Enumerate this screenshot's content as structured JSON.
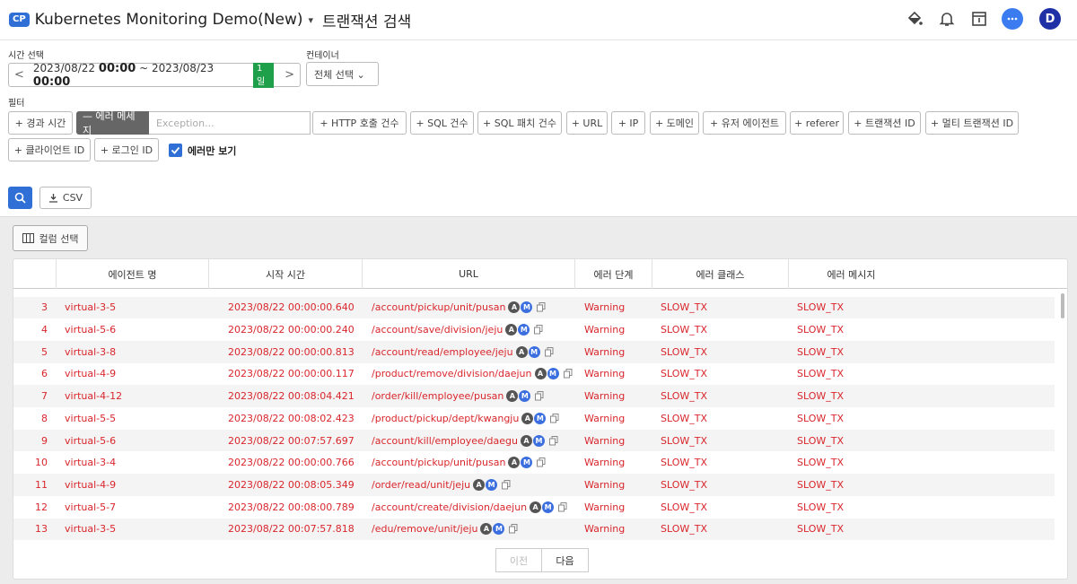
{
  "header": {
    "badge": "CP",
    "project": "Kubernetes Monitoring Demo(New)",
    "caret": "▾",
    "title": "트랜잭션 검색",
    "avatar": "D"
  },
  "filters": {
    "time_label": "시간 선택",
    "time_prev": "<",
    "time_next": ">",
    "time_from_date": "2023/08/22",
    "time_from_hm": "00:00",
    "time_sep": "~",
    "time_to_date": "2023/08/23",
    "time_to_hm": "00:00",
    "time_range": "1일",
    "container_label": "컨테이너",
    "container_value": "전체 선택 ⌄",
    "filter_label": "필터",
    "chips": [
      "+ 경과 시간",
      "+ HTTP 호출 건수",
      "+ SQL 건수",
      "+ SQL 패치 건수",
      "+ URL",
      "+ IP",
      "+ 도메인",
      "+ 유저 에이전트",
      "+ referer",
      "+ 트랜잭션 ID",
      "+ 멀티 트랜잭션 ID",
      "+ 클라이언트 ID",
      "+ 로그인 ID"
    ],
    "active_chip": "— 에러 메세지",
    "exception_placeholder": "Exception...",
    "errors_only_label": "에러만 보기",
    "csv_label": "CSV"
  },
  "table": {
    "column_select_label": "컬럼 선택",
    "columns": [
      "에이전트 명",
      "시작 시간",
      "URL",
      "에러 단계",
      "에러 클래스",
      "에러 메시지"
    ],
    "rows": [
      {
        "no": "3",
        "agent": "virtual-3-5",
        "time": "2023/08/22 00:00:00.640",
        "url": "/account/pickup/unit/pusan",
        "stage": "Warning",
        "cls": "SLOW_TX",
        "msg": "SLOW_TX"
      },
      {
        "no": "4",
        "agent": "virtual-5-6",
        "time": "2023/08/22 00:00:00.240",
        "url": "/account/save/division/jeju",
        "stage": "Warning",
        "cls": "SLOW_TX",
        "msg": "SLOW_TX"
      },
      {
        "no": "5",
        "agent": "virtual-3-8",
        "time": "2023/08/22 00:00:00.813",
        "url": "/account/read/employee/jeju",
        "stage": "Warning",
        "cls": "SLOW_TX",
        "msg": "SLOW_TX"
      },
      {
        "no": "6",
        "agent": "virtual-4-9",
        "time": "2023/08/22 00:00:00.117",
        "url": "/product/remove/division/daejun",
        "stage": "Warning",
        "cls": "SLOW_TX",
        "msg": "SLOW_TX"
      },
      {
        "no": "7",
        "agent": "virtual-4-12",
        "time": "2023/08/22 00:08:04.421",
        "url": "/order/kill/employee/pusan",
        "stage": "Warning",
        "cls": "SLOW_TX",
        "msg": "SLOW_TX"
      },
      {
        "no": "8",
        "agent": "virtual-5-5",
        "time": "2023/08/22 00:08:02.423",
        "url": "/product/pickup/dept/kwangju",
        "stage": "Warning",
        "cls": "SLOW_TX",
        "msg": "SLOW_TX"
      },
      {
        "no": "9",
        "agent": "virtual-5-6",
        "time": "2023/08/22 00:07:57.697",
        "url": "/account/kill/employee/daegu",
        "stage": "Warning",
        "cls": "SLOW_TX",
        "msg": "SLOW_TX"
      },
      {
        "no": "10",
        "agent": "virtual-3-4",
        "time": "2023/08/22 00:00:00.766",
        "url": "/account/pickup/unit/pusan",
        "stage": "Warning",
        "cls": "SLOW_TX",
        "msg": "SLOW_TX"
      },
      {
        "no": "11",
        "agent": "virtual-4-9",
        "time": "2023/08/22 00:08:05.349",
        "url": "/order/read/unit/jeju",
        "stage": "Warning",
        "cls": "SLOW_TX",
        "msg": "SLOW_TX"
      },
      {
        "no": "12",
        "agent": "virtual-5-7",
        "time": "2023/08/22 00:08:00.789",
        "url": "/account/create/division/daejun",
        "stage": "Warning",
        "cls": "SLOW_TX",
        "msg": "SLOW_TX"
      },
      {
        "no": "13",
        "agent": "virtual-3-5",
        "time": "2023/08/22 00:07:57.818",
        "url": "/edu/remove/unit/jeju",
        "stage": "Warning",
        "cls": "SLOW_TX",
        "msg": "SLOW_TX"
      }
    ],
    "badge_a": "A",
    "badge_m": "M"
  },
  "pager": {
    "prev": "이전",
    "next": "다음"
  },
  "colors": {
    "accent": "#2f6fd6",
    "error_text": "#d9262c",
    "day_badge": "#1ea04b"
  }
}
